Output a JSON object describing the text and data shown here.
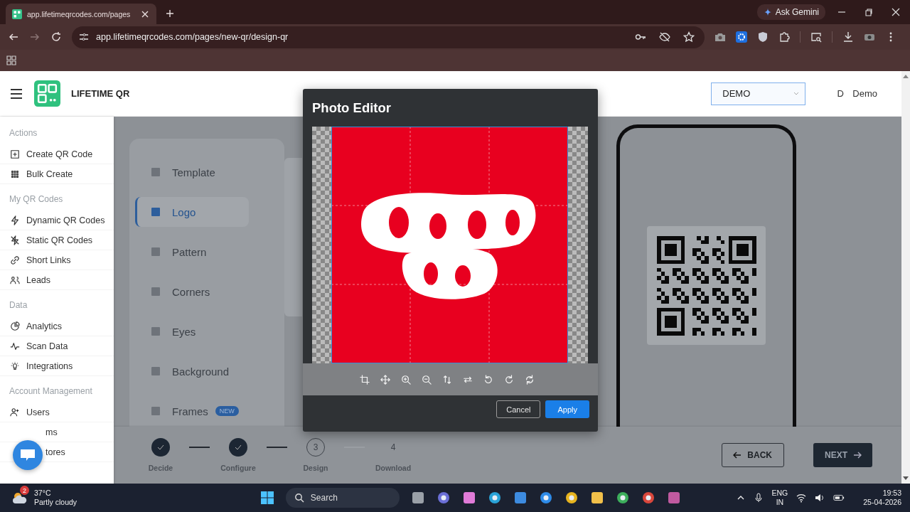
{
  "browser": {
    "tab_title": "app.lifetimeqrcodes.com/pages",
    "url": "app.lifetimeqrcodes.com/pages/new-qr/design-qr",
    "assistant": "Ask Gemini"
  },
  "header": {
    "brand": "LIFETIME QR",
    "workspace": "DEMO",
    "avatar": "D",
    "user": "Demo"
  },
  "sidebar": {
    "sections": [
      {
        "title": "Actions",
        "items": [
          {
            "label": "Create QR Code",
            "kind": "plus"
          },
          {
            "label": "Bulk Create",
            "kind": "grid"
          }
        ]
      },
      {
        "title": "My QR Codes",
        "items": [
          {
            "label": "Dynamic QR Codes",
            "kind": "bolt"
          },
          {
            "label": "Static QR Codes",
            "kind": "nobolt"
          },
          {
            "label": "Short Links",
            "kind": "link"
          },
          {
            "label": "Leads",
            "kind": "people"
          }
        ]
      },
      {
        "title": "Data",
        "items": [
          {
            "label": "Analytics",
            "kind": "pie"
          },
          {
            "label": "Scan Data",
            "kind": "pulse"
          },
          {
            "label": "Integrations",
            "kind": "bulb"
          }
        ]
      },
      {
        "title": "Account Management",
        "items": [
          {
            "label": "Users",
            "kind": "user"
          },
          {
            "label": "ms",
            "kind": "covered"
          },
          {
            "label": "tores",
            "kind": "covered"
          }
        ]
      }
    ]
  },
  "design_menu": [
    {
      "label": "Template",
      "selected": false
    },
    {
      "label": "Logo",
      "selected": true
    },
    {
      "label": "Pattern",
      "selected": false
    },
    {
      "label": "Corners",
      "selected": false
    },
    {
      "label": "Eyes",
      "selected": false
    },
    {
      "label": "Background",
      "selected": false
    },
    {
      "label": "Frames",
      "selected": false,
      "badge": "NEW"
    }
  ],
  "stepper": [
    {
      "label": "Decide",
      "completed": true
    },
    {
      "label": "Configure",
      "completed": true
    },
    {
      "number": "3",
      "label": "Design",
      "completed": false,
      "current": true
    },
    {
      "number": "4",
      "label": "Download",
      "completed": false,
      "current": false
    }
  ],
  "buttons": {
    "back": "BACK",
    "next": "NEXT"
  },
  "dialog": {
    "title": "Photo Editor",
    "cancel": "Cancel",
    "apply": "Apply"
  },
  "taskbar": {
    "weather_badge": "2",
    "temperature": "37°C",
    "weather": "Partly cloudy",
    "search": "Search",
    "language": "ENG",
    "region": "IN",
    "time": "19:53",
    "date": "25-04-2026"
  }
}
